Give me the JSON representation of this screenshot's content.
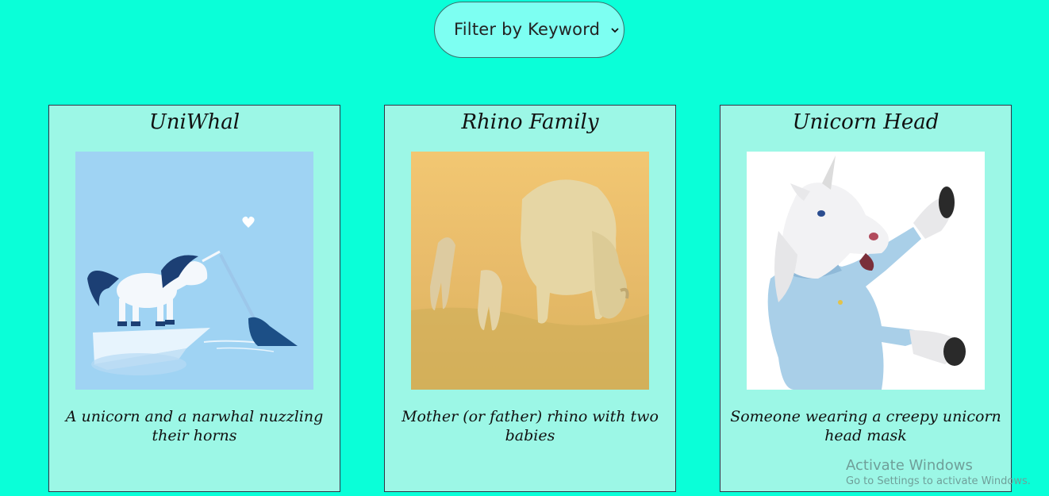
{
  "filter": {
    "label": "Filter by Keyword"
  },
  "cards": [
    {
      "title": "UniWhal",
      "description": "A unicorn and a narwhal nuzzling their horns"
    },
    {
      "title": "Rhino Family",
      "description": "Mother (or father) rhino with two babies"
    },
    {
      "title": "Unicorn Head",
      "description": "Someone wearing a creepy unicorn head mask"
    }
  ],
  "watermark": {
    "line1": "Activate Windows",
    "line2": "Go to Settings to activate Windows."
  },
  "colors": {
    "page_background": "#0affd8",
    "card_background": "#9cf7e6",
    "select_background": "#7dfff2"
  }
}
